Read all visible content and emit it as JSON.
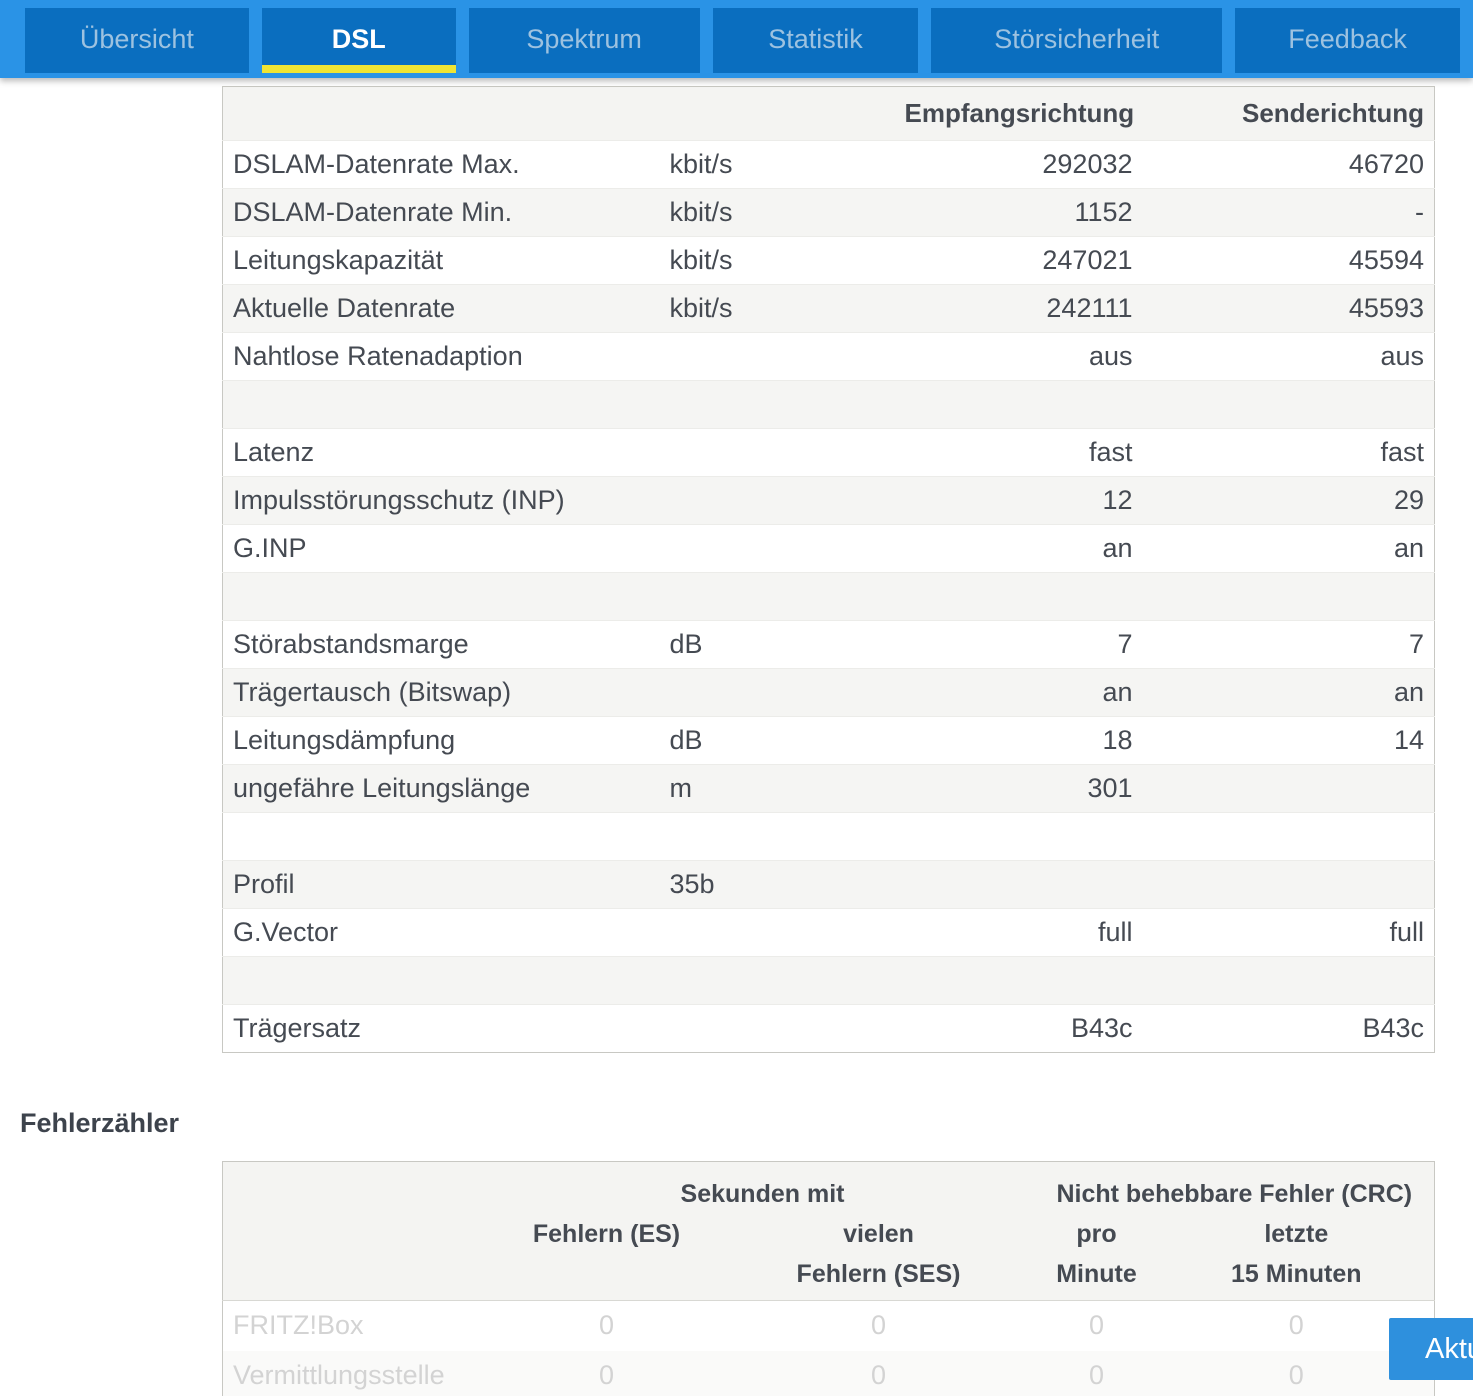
{
  "colors": {
    "nav_bg": "#2a93e6",
    "tab_bg": "#0a6ebf",
    "tab_text": "#9dc2e0",
    "tab_active_text": "#ffffff",
    "active_underline": "#f0e433",
    "button_bg": "#2e90dd",
    "button_text": "#ffffff",
    "table_border": "#c8c8c3",
    "row_alt_bg": "#f5f5f3",
    "header_bg": "#f4f4f2",
    "text_dark": "#454a52",
    "text_faded": "#d3d3d3",
    "heading_text": "#3d434c"
  },
  "navbar": {
    "active_tab": "DSL",
    "tabs": [
      {
        "label": "Übersicht"
      },
      {
        "label": "DSL"
      },
      {
        "label": "Spektrum"
      },
      {
        "label": "Statistik"
      },
      {
        "label": "Störsicherheit"
      },
      {
        "label": "Feedback"
      }
    ]
  },
  "dsl_table": {
    "col_headers": {
      "rx": "Empfangsrichtung",
      "tx": "Senderichtung"
    },
    "rows": [
      {
        "label": "DSLAM-Datenrate Max.",
        "unit": "kbit/s",
        "rx": "292032",
        "tx": "46720"
      },
      {
        "label": "DSLAM-Datenrate Min.",
        "unit": "kbit/s",
        "rx": "1152",
        "tx": "-"
      },
      {
        "label": "Leitungskapazität",
        "unit": "kbit/s",
        "rx": "247021",
        "tx": "45594"
      },
      {
        "label": "Aktuelle Datenrate",
        "unit": "kbit/s",
        "rx": "242111",
        "tx": "45593"
      },
      {
        "label": "Nahtlose Ratenadaption",
        "unit": "",
        "rx": "aus",
        "tx": "aus"
      },
      {
        "label": "",
        "unit": "",
        "rx": "",
        "tx": ""
      },
      {
        "label": "Latenz",
        "unit": "",
        "rx": "fast",
        "tx": "fast"
      },
      {
        "label": "Impulsstörungsschutz (INP)",
        "unit": "",
        "rx": "12",
        "tx": "29"
      },
      {
        "label": "G.INP",
        "unit": "",
        "rx": "an",
        "tx": "an"
      },
      {
        "label": "",
        "unit": "",
        "rx": "",
        "tx": ""
      },
      {
        "label": "Störabstandsmarge",
        "unit": "dB",
        "rx": "7",
        "tx": "7"
      },
      {
        "label": "Trägertausch (Bitswap)",
        "unit": "",
        "rx": "an",
        "tx": "an"
      },
      {
        "label": "Leitungsdämpfung",
        "unit": "dB",
        "rx": "18",
        "tx": "14"
      },
      {
        "label": "ungefähre Leitungslänge",
        "unit": "m",
        "rx": "301",
        "tx": ""
      },
      {
        "label": "",
        "unit": "",
        "rx": "",
        "tx": ""
      },
      {
        "label": "Profil",
        "unit": "35b",
        "rx": "",
        "tx": ""
      },
      {
        "label": "G.Vector",
        "unit": "",
        "rx": "full",
        "tx": "full"
      },
      {
        "label": "",
        "unit": "",
        "rx": "",
        "tx": ""
      },
      {
        "label": "Trägersatz",
        "unit": "",
        "rx": "B43c",
        "tx": "B43c"
      }
    ]
  },
  "error_counters": {
    "heading": "Fehlerzähler",
    "group_headers": {
      "seconds": "Sekunden mit",
      "crc": "Nicht behebbare Fehler (CRC)"
    },
    "col_headers": {
      "es": "Fehlern (ES)",
      "ses": "vielen\nFehlern (SES)",
      "per_minute": "pro\nMinute",
      "last_15_minutes": "letzte\n15 Minuten"
    },
    "rows": [
      {
        "label": "FRITZ!Box",
        "es": "0",
        "ses": "0",
        "per_minute": "0",
        "last_15_minutes": "0"
      },
      {
        "label": "Vermittlungsstelle",
        "es": "0",
        "ses": "0",
        "per_minute": "0",
        "last_15_minutes": "0"
      }
    ]
  },
  "refresh_button": {
    "label": "Aktualisieren"
  }
}
